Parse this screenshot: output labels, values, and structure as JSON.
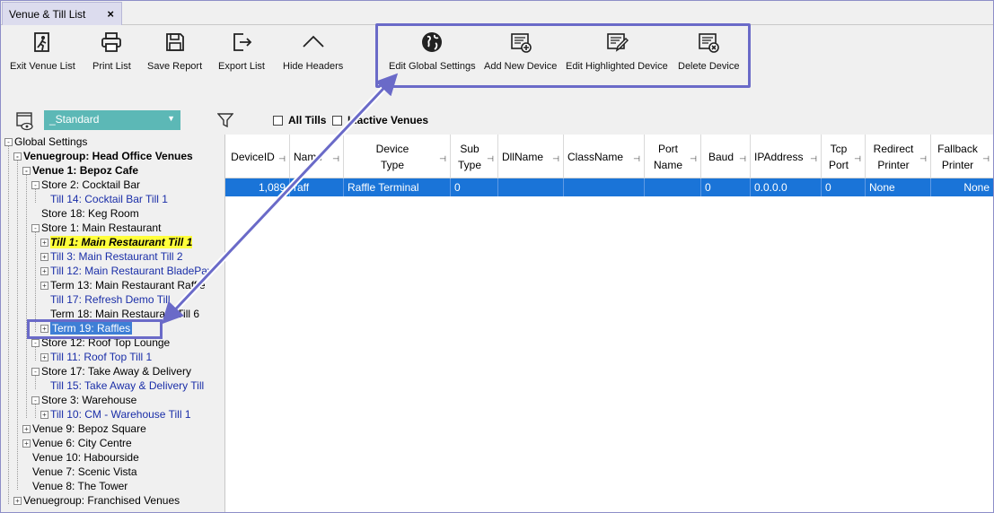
{
  "tab": {
    "title": "Venue & Till List",
    "close": "×"
  },
  "ribbon": {
    "buttons": [
      {
        "label": "Exit Venue List",
        "icon": "exit-icon"
      },
      {
        "label": "Print List",
        "icon": "printer-icon"
      },
      {
        "label": "Save Report",
        "icon": "floppy-disk-icon"
      },
      {
        "label": "Export List",
        "icon": "export-icon"
      },
      {
        "label": "Hide Headers",
        "icon": "chevron-up-icon"
      },
      {
        "label": "Edit Global Settings",
        "icon": "globe-icon"
      },
      {
        "label": "Add New Device",
        "icon": "add-device-icon"
      },
      {
        "label": "Edit Highlighted Device",
        "icon": "edit-device-icon"
      },
      {
        "label": "Delete Device",
        "icon": "delete-device-icon"
      }
    ]
  },
  "filters": {
    "layout_value": "_Standard",
    "all_tills": "All Tills",
    "inactive_venues": "Inactive Venues"
  },
  "tree": [
    {
      "label": "Global Settings",
      "expander": "-"
    },
    {
      "label": "Venuegroup: Head Office Venues",
      "expander": "-"
    },
    {
      "label": "Venue 1: Bepoz Cafe",
      "expander": "-"
    },
    {
      "label": "Store 2: Cocktail Bar",
      "expander": "-"
    },
    {
      "label": "Till 14: Cocktail Bar Till 1",
      "expander": ""
    },
    {
      "label": "Store 18: Keg Room",
      "expander": ""
    },
    {
      "label": "Store 1: Main Restaurant",
      "expander": "-"
    },
    {
      "label": "Till 1: Main Restaurant Till 1",
      "expander": "+"
    },
    {
      "label": "Till 3: Main Restaurant Till 2",
      "expander": "+"
    },
    {
      "label": "Till 12: Main Restaurant BladePay",
      "expander": "+"
    },
    {
      "label": "Term 13: Main Restaurant Raffle",
      "expander": "+"
    },
    {
      "label": "Till 17: Refresh Demo Till",
      "expander": ""
    },
    {
      "label": "Term 18: Main Restaurant Till 6",
      "expander": ""
    },
    {
      "label": "Term 19: Raffles",
      "expander": "+"
    },
    {
      "label": "Store 12: Roof Top Lounge",
      "expander": "-"
    },
    {
      "label": "Till 11: Roof Top Till 1",
      "expander": "+"
    },
    {
      "label": "Store 17: Take Away & Delivery",
      "expander": "-"
    },
    {
      "label": "Till 15: Take Away & Delivery Till",
      "expander": ""
    },
    {
      "label": "Store 3: Warehouse",
      "expander": "-"
    },
    {
      "label": "Till 10: CM - Warehouse Till 1",
      "expander": "+"
    },
    {
      "label": "Venue 9: Bepoz Square",
      "expander": "+"
    },
    {
      "label": "Venue 6: City Centre",
      "expander": "+"
    },
    {
      "label": "Venue 10: Habourside",
      "expander": ""
    },
    {
      "label": "Venue 7: Scenic Vista",
      "expander": ""
    },
    {
      "label": "Venue 8: The Tower",
      "expander": ""
    },
    {
      "label": "Venuegroup: Franchised Venues",
      "expander": "+"
    }
  ],
  "grid": {
    "columns": [
      "DeviceID",
      "Name",
      "Device\nType",
      "Sub\nType",
      "DllName",
      "ClassName",
      "Port\nName",
      "Baud",
      "IPAddress",
      "Tcp\nPort",
      "Redirect\nPrinter",
      "Fallback\nPrinter"
    ],
    "rows": [
      [
        "1,089",
        "raff",
        "Raffle Terminal",
        "0",
        "",
        "",
        "",
        "0",
        "0.0.0.0",
        "0",
        "None",
        "None"
      ]
    ]
  },
  "colors": {
    "accent": "#6a6ac8",
    "selection": "#1a74d8",
    "layout_select": "#5cb8b6",
    "highlight": "#ffff3b"
  }
}
